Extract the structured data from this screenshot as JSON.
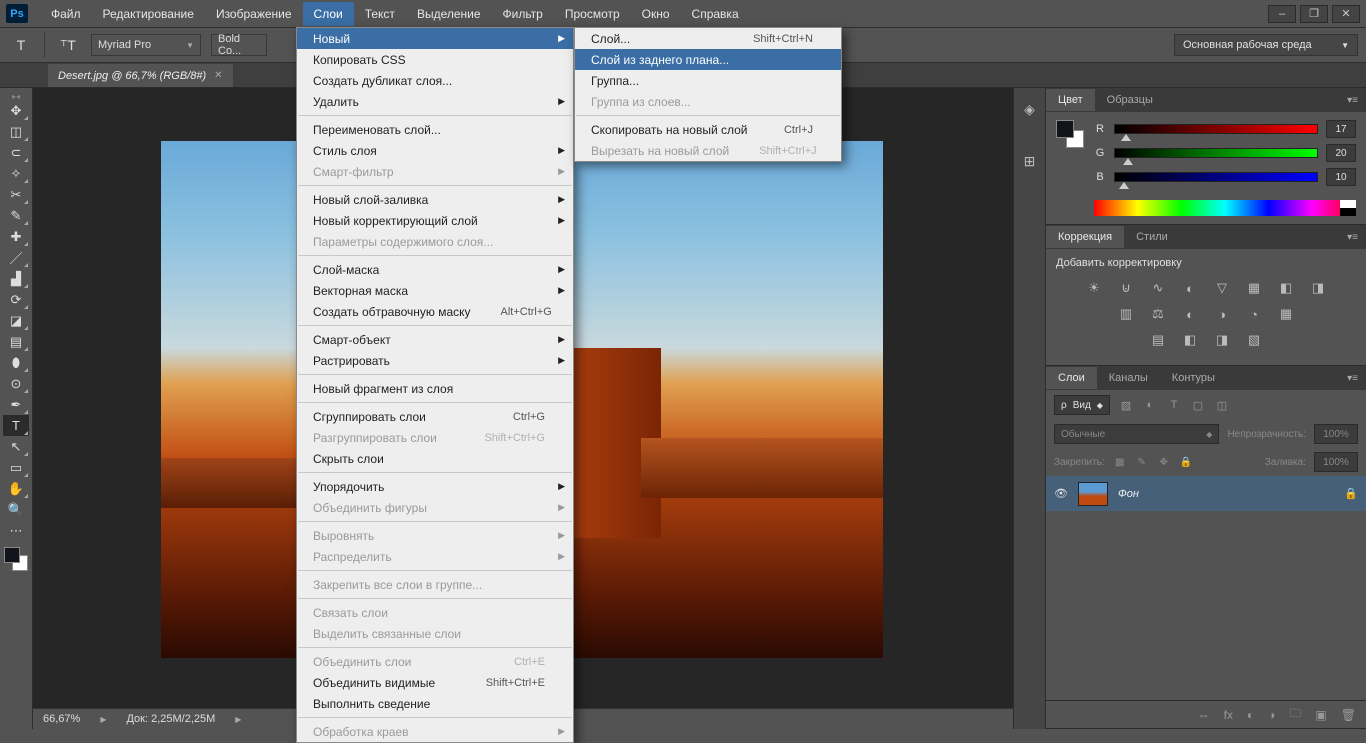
{
  "menubar": {
    "items": [
      "Файл",
      "Редактирование",
      "Изображение",
      "Слои",
      "Текст",
      "Выделение",
      "Фильтр",
      "Просмотр",
      "Окно",
      "Справка"
    ],
    "open_index": 3
  },
  "optbar": {
    "font": "Myriad Pro",
    "style": "Bold Co...",
    "workspace": "Основная рабочая среда"
  },
  "doc": {
    "tab": "Desert.jpg @ 66,7% (RGB/8#)"
  },
  "status": {
    "zoom": "66,67%",
    "doc": "Док: 2,25M/2,25M"
  },
  "menu_layers": [
    {
      "t": "Новый",
      "sub": true,
      "hl": true
    },
    {
      "t": "Копировать CSS"
    },
    {
      "t": "Создать дубликат слоя..."
    },
    {
      "t": "Удалить",
      "sub": true
    },
    {
      "sep": true
    },
    {
      "t": "Переименовать слой..."
    },
    {
      "t": "Стиль слоя",
      "sub": true
    },
    {
      "t": "Смарт-фильтр",
      "sub": true,
      "dis": true
    },
    {
      "sep": true
    },
    {
      "t": "Новый слой-заливка",
      "sub": true
    },
    {
      "t": "Новый корректирующий слой",
      "sub": true
    },
    {
      "t": "Параметры содержимого слоя...",
      "dis": true
    },
    {
      "sep": true
    },
    {
      "t": "Слой-маска",
      "sub": true
    },
    {
      "t": "Векторная маска",
      "sub": true
    },
    {
      "t": "Создать обтравочную маску",
      "sc": "Alt+Ctrl+G"
    },
    {
      "sep": true
    },
    {
      "t": "Смарт-объект",
      "sub": true
    },
    {
      "t": "Растрировать",
      "sub": true
    },
    {
      "sep": true
    },
    {
      "t": "Новый фрагмент из слоя"
    },
    {
      "sep": true
    },
    {
      "t": "Сгруппировать слои",
      "sc": "Ctrl+G"
    },
    {
      "t": "Разгруппировать слои",
      "sc": "Shift+Ctrl+G",
      "dis": true
    },
    {
      "t": "Скрыть слои"
    },
    {
      "sep": true
    },
    {
      "t": "Упорядочить",
      "sub": true
    },
    {
      "t": "Объединить фигуры",
      "sub": true,
      "dis": true
    },
    {
      "sep": true
    },
    {
      "t": "Выровнять",
      "sub": true,
      "dis": true
    },
    {
      "t": "Распределить",
      "sub": true,
      "dis": true
    },
    {
      "sep": true
    },
    {
      "t": "Закрепить все слои в группе...",
      "dis": true
    },
    {
      "sep": true
    },
    {
      "t": "Связать слои",
      "dis": true
    },
    {
      "t": "Выделить связанные слои",
      "dis": true
    },
    {
      "sep": true
    },
    {
      "t": "Объединить слои",
      "sc": "Ctrl+E",
      "dis": true
    },
    {
      "t": "Объединить видимые",
      "sc": "Shift+Ctrl+E"
    },
    {
      "t": "Выполнить сведение"
    },
    {
      "sep": true
    },
    {
      "t": "Обработка краев",
      "sub": true,
      "dis": true
    }
  ],
  "menu_new": [
    {
      "t": "Слой...",
      "sc": "Shift+Ctrl+N"
    },
    {
      "t": "Слой из заднего плана...",
      "hl": true
    },
    {
      "t": "Группа..."
    },
    {
      "t": "Группа из слоев...",
      "dis": true
    },
    {
      "sep": true
    },
    {
      "t": "Скопировать на новый слой",
      "sc": "Ctrl+J"
    },
    {
      "t": "Вырезать на новый слой",
      "sc": "Shift+Ctrl+J",
      "dis": true
    }
  ],
  "color_panel": {
    "tabs": [
      "Цвет",
      "Образцы"
    ],
    "r": 17,
    "g": 20,
    "b": 10
  },
  "adj_panel": {
    "tabs": [
      "Коррекция",
      "Стили"
    ],
    "title": "Добавить корректировку"
  },
  "layers_panel": {
    "tabs": [
      "Слои",
      "Каналы",
      "Контуры"
    ],
    "kind_label": "Вид",
    "blend": "Обычные",
    "opacity_label": "Непрозрачность:",
    "opacity": "100%",
    "lock_label": "Закрепить:",
    "fill_label": "Заливка:",
    "fill": "100%",
    "layer_name": "Фон"
  },
  "kind_icon": "ρ",
  "search_icon": "🔍"
}
